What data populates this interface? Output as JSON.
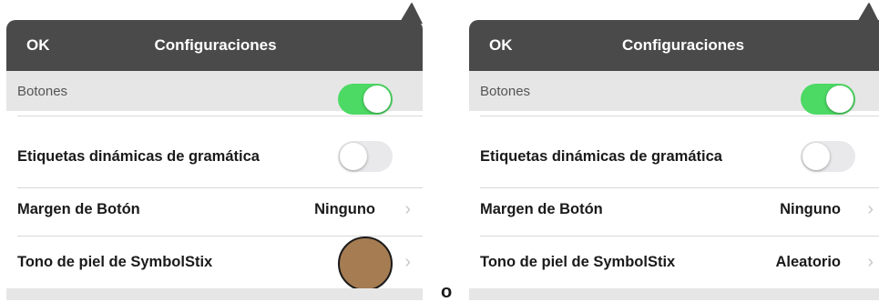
{
  "panels": [
    {
      "header": {
        "ok_label": "OK",
        "title": "Configuraciones"
      },
      "section": "Botones",
      "grammar_label": "Etiquetas dinámicas de gramática",
      "margin": {
        "label": "Margen de Botón",
        "value": "Ninguno"
      },
      "skin": {
        "label": "Tono de piel de SymbolStix",
        "value": "",
        "swatch_color": "#a67c52"
      }
    },
    {
      "header": {
        "ok_label": "OK",
        "title": "Configuraciones"
      },
      "section": "Botones",
      "grammar_label": "Etiquetas dinámicas de gramática",
      "margin": {
        "label": "Margen de Botón",
        "value": "Ninguno"
      },
      "skin": {
        "label": "Tono de piel de SymbolStix",
        "value": "Aleatorio"
      }
    }
  ],
  "toggles": {
    "top_toggle_on": true,
    "grammar_toggle_on": false
  },
  "separator_label": "o",
  "colors": {
    "header_bg": "#4a4a4a",
    "section_bg": "#e6e6e6",
    "toggle_on": "#4cd964",
    "chevron": "#c7c7cc"
  },
  "icons": {
    "chevron": "chevron-right-icon"
  }
}
